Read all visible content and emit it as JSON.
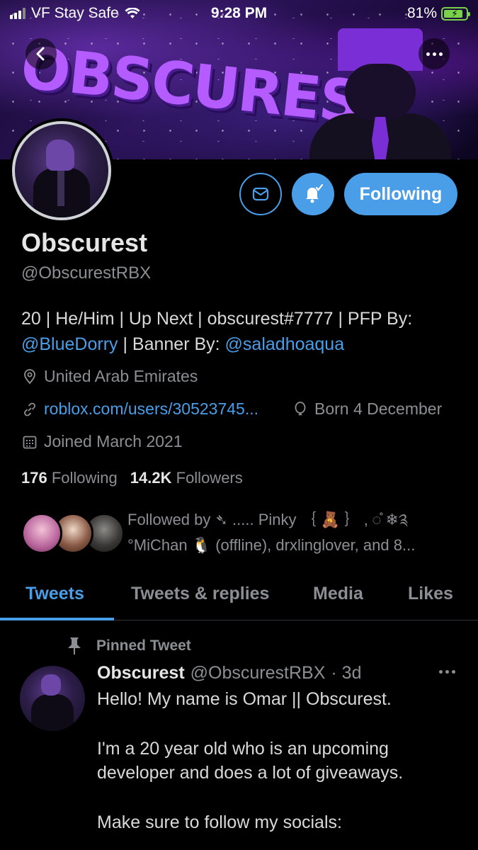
{
  "status_bar": {
    "carrier": "VF Stay Safe",
    "time": "9:28 PM",
    "battery": "81%"
  },
  "banner": {
    "title_art": "OBSCUREST"
  },
  "profile": {
    "name": "Obscurest",
    "handle": "@ObscurestRBX",
    "bio": {
      "line1": "20 | He/Him | Up Next | obscurest#7777 | PFP By:",
      "mention1": "@BlueDorry",
      "mid_text": " | Banner By: ",
      "mention2": "@saladhoaqua"
    },
    "location": "United Arab Emirates",
    "website": "roblox.com/users/30523745...",
    "born": "Born 4 December",
    "joined": "Joined March 2021",
    "following_count": "176",
    "following_label": "Following",
    "followers_count": "14.2K",
    "followers_label": "Followers",
    "followed_by": "Followed by ➴ ..... Pinky ｛ 🧸 ｝ ‚ ◌̊ ❄︎༉ °MiChan 🐧 (offline), drxlinglover, and 8..."
  },
  "actions": {
    "following_button": "Following"
  },
  "tabs": [
    {
      "label": "Tweets",
      "active": true
    },
    {
      "label": "Tweets & replies",
      "active": false
    },
    {
      "label": "Media",
      "active": false
    },
    {
      "label": "Likes",
      "active": false
    }
  ],
  "tweet": {
    "pinned_label": "Pinned Tweet",
    "author_name": "Obscurest",
    "author_handle": "@ObscurestRBX",
    "time": "· 3d",
    "paragraphs": [
      "Hello! My name is Omar || Obscurest.",
      "I'm a 20 year old who is an upcoming developer and does a lot of giveaways.",
      "Make sure to follow my socials:"
    ]
  },
  "colors": {
    "accent": "#4a9ee8",
    "background": "#000000",
    "secondary_text": "#8b8f93",
    "primary_text": "#d9d9d9",
    "battery": "#7ad14a"
  },
  "icons": [
    "back-arrow-icon",
    "more-icon",
    "mail-icon",
    "bell-icon",
    "location-icon",
    "link-icon",
    "balloon-icon",
    "calendar-icon",
    "pin-icon"
  ]
}
